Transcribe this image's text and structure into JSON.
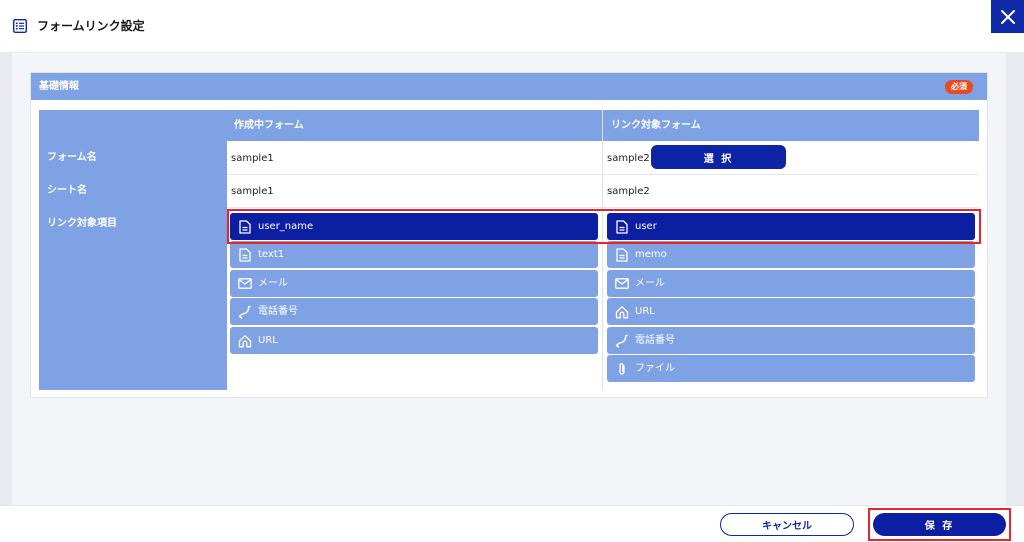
{
  "header": {
    "title": "フォームリンク設定",
    "icon": "list-icon"
  },
  "close_icon": "close-icon",
  "card": {
    "title": "基礎情報",
    "required_badge": "必須"
  },
  "table": {
    "col_current": "作成中フォーム",
    "col_target": "リンク対象フォーム",
    "row_form_name": "フォーム名",
    "row_sheet_name": "シート名",
    "row_link_items": "リンク対象項目",
    "current_form_name": "sample1",
    "target_form_name": "sample2",
    "select_button": "選 択",
    "current_sheet_name": "sample1",
    "target_sheet_name": "sample2"
  },
  "current_fields": [
    {
      "label": "user_name",
      "icon": "document-icon",
      "selected": true
    },
    {
      "label": "text1",
      "icon": "document-icon",
      "selected": false
    },
    {
      "label": "メール",
      "icon": "mail-icon",
      "selected": false
    },
    {
      "label": "電話番号",
      "icon": "phone-icon",
      "selected": false
    },
    {
      "label": "URL",
      "icon": "home-icon",
      "selected": false
    }
  ],
  "target_fields": [
    {
      "label": "user",
      "icon": "document-icon",
      "selected": true
    },
    {
      "label": "memo",
      "icon": "document-icon",
      "selected": false
    },
    {
      "label": "メール",
      "icon": "mail-icon",
      "selected": false
    },
    {
      "label": "URL",
      "icon": "home-icon",
      "selected": false
    },
    {
      "label": "電話番号",
      "icon": "phone-icon",
      "selected": false
    },
    {
      "label": "ファイル",
      "icon": "paperclip-icon",
      "selected": false
    }
  ],
  "footer": {
    "cancel_label": "キャンセル",
    "save_label": "保 存"
  },
  "colors": {
    "accent": "#0c1fa3",
    "header_blue": "#7ea2e4",
    "required_badge": "#e94a1f",
    "highlight_outline": "#e6262e"
  }
}
